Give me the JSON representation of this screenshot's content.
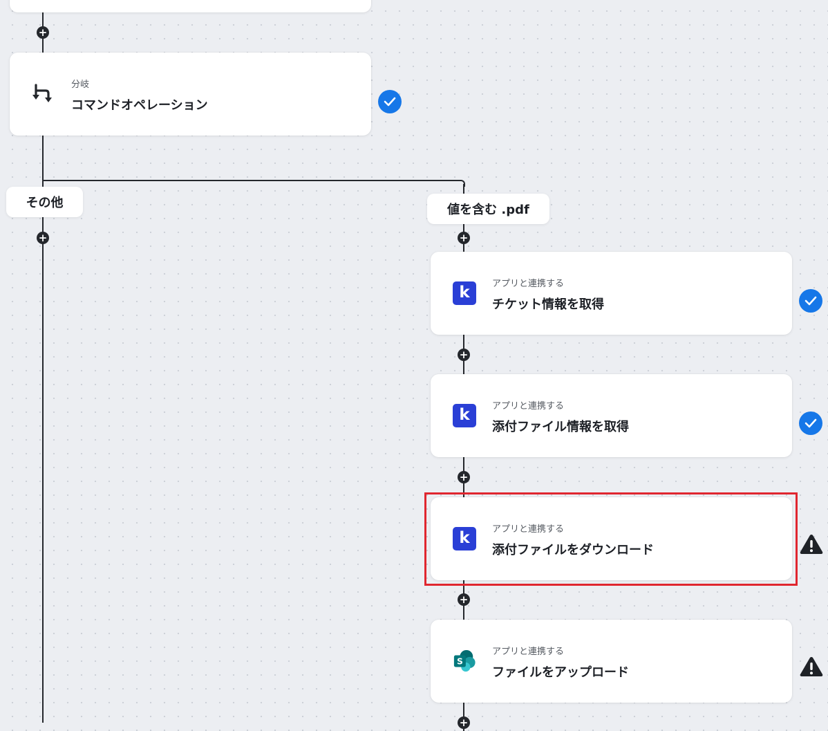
{
  "flow": {
    "branch_step": {
      "subtitle": "分岐",
      "title": "コマンドオペレーション",
      "icon": "branch-icon",
      "status": "completed"
    },
    "branches": {
      "other_label": "その他",
      "match_label": "値を含む .pdf"
    },
    "steps": [
      {
        "subtitle": "アプリと連携する",
        "title": "チケット情報を取得",
        "icon": "kintone-k-icon",
        "icon_glyph": "k",
        "status": "completed"
      },
      {
        "subtitle": "アプリと連携する",
        "title": "添付ファイル情報を取得",
        "icon": "kintone-k-icon",
        "icon_glyph": "k",
        "status": "completed"
      },
      {
        "subtitle": "アプリと連携する",
        "title": "添付ファイルをダウンロード",
        "icon": "kintone-k-icon",
        "icon_glyph": "k",
        "status": "warning",
        "highlighted": true
      },
      {
        "subtitle": "アプリと連携する",
        "title": "ファイルをアップロード",
        "icon": "sharepoint-icon",
        "icon_glyph": "S",
        "status": "warning"
      }
    ],
    "add_glyph": "+"
  },
  "colors": {
    "connector": "#24272c",
    "check": "#1677e8",
    "highlight": "#e0262f",
    "kintone": "#2a3fd6",
    "sharepoint": "#037c7c"
  }
}
